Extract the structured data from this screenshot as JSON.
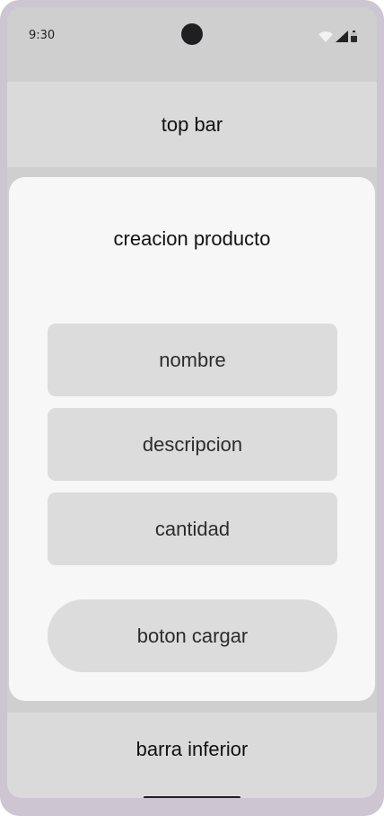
{
  "status_bar": {
    "time": "9:30",
    "icons": [
      "wifi-icon",
      "signal-icon",
      "battery-icon"
    ]
  },
  "top_bar": {
    "title": "top bar"
  },
  "form": {
    "title": "creacion producto",
    "fields": {
      "nombre": "nombre",
      "descripcion": "descripcion",
      "cantidad": "cantidad"
    },
    "submit_label": "boton cargar"
  },
  "bottom_bar": {
    "label": "barra inferior"
  },
  "colors": {
    "device_frame": "#cdc6d2",
    "screen_background": "#cfcfcf",
    "bar_background": "#dadada",
    "card_background": "#f7f7f7",
    "field_background": "#dcdcdc",
    "text_primary": "#111111"
  }
}
